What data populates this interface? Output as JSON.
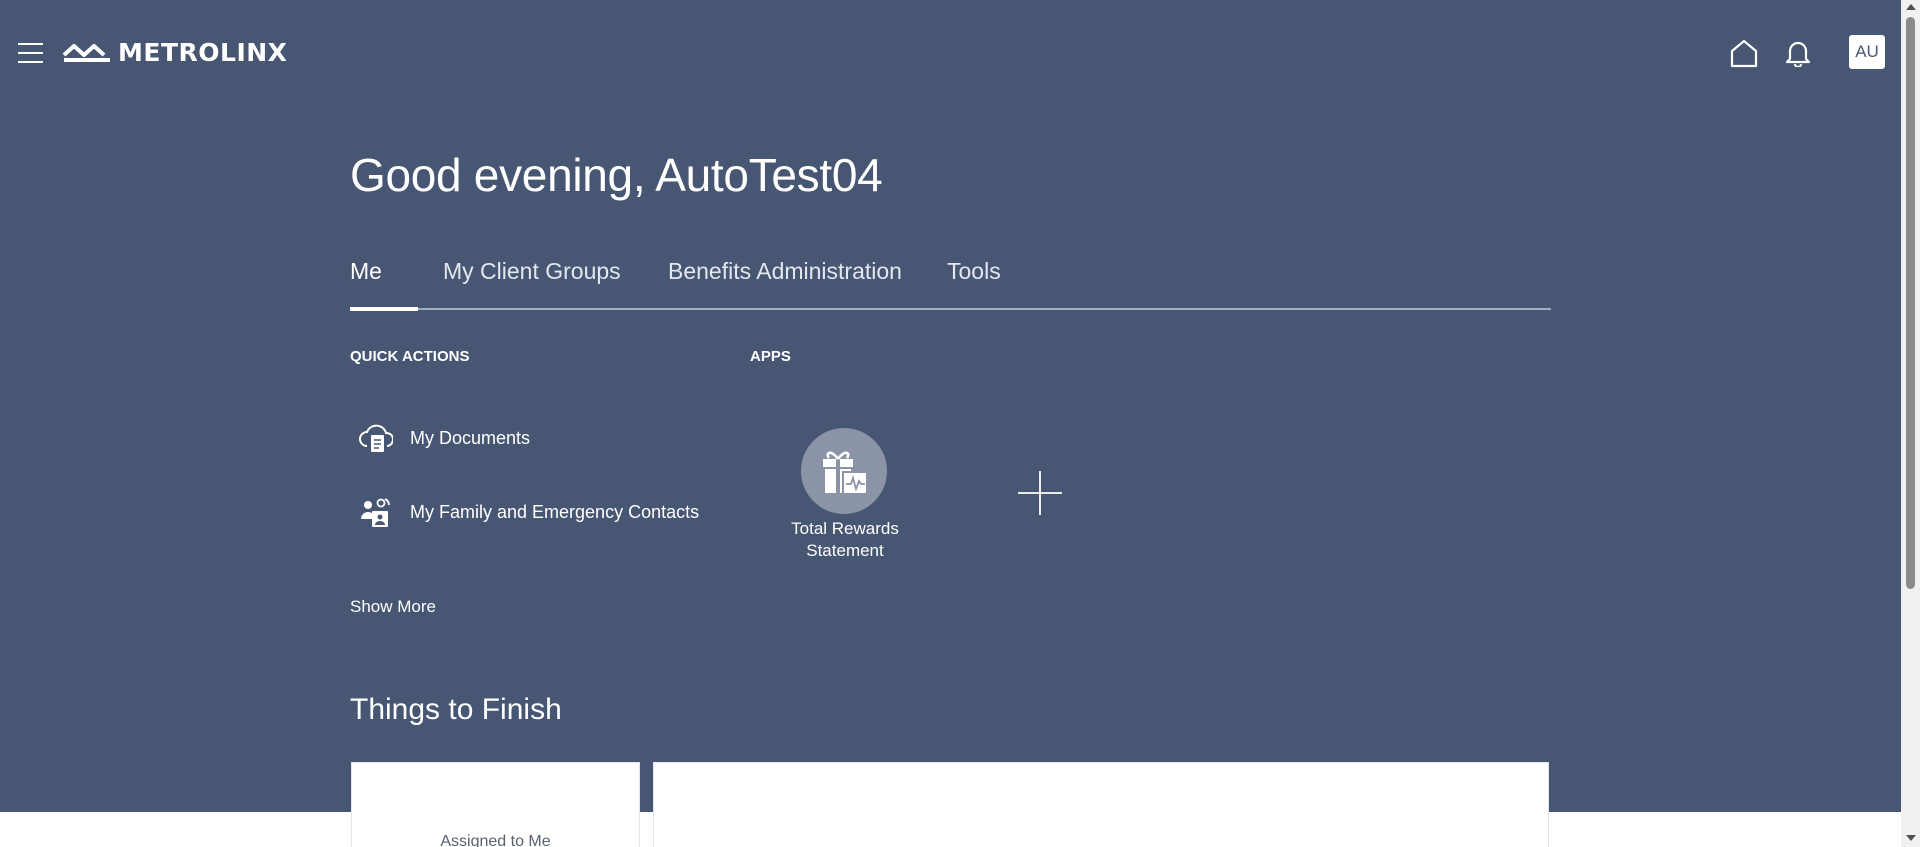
{
  "header": {
    "menu_icon": "hamburger-menu-icon",
    "logo_text": "METROLINX",
    "home_icon": "home-icon",
    "notifications_icon": "bell-icon",
    "avatar_initials": "AU"
  },
  "greeting": "Good evening, AutoTest04",
  "tabs": [
    {
      "label": "Me",
      "active": true
    },
    {
      "label": "My Client Groups",
      "active": false
    },
    {
      "label": "Benefits Administration",
      "active": false
    },
    {
      "label": "Tools",
      "active": false
    }
  ],
  "quick_actions": {
    "title": "QUICK ACTIONS",
    "items": [
      {
        "label": "My Documents",
        "icon": "cloud-document-icon"
      },
      {
        "label": "My Family and Emergency Contacts",
        "icon": "family-contacts-icon"
      }
    ],
    "show_more": "Show More"
  },
  "apps": {
    "title": "APPS",
    "items": [
      {
        "label_line1": "Total Rewards",
        "label_line2": "Statement",
        "icon": "gift-icon"
      }
    ],
    "add_icon": "plus-icon"
  },
  "things_to_finish": {
    "title": "Things to Finish",
    "cards": [
      {
        "label": "Assigned to Me"
      }
    ]
  },
  "colors": {
    "hero_background": "#475672",
    "app_circle": "#8b94a6",
    "text": "#ffffff"
  }
}
